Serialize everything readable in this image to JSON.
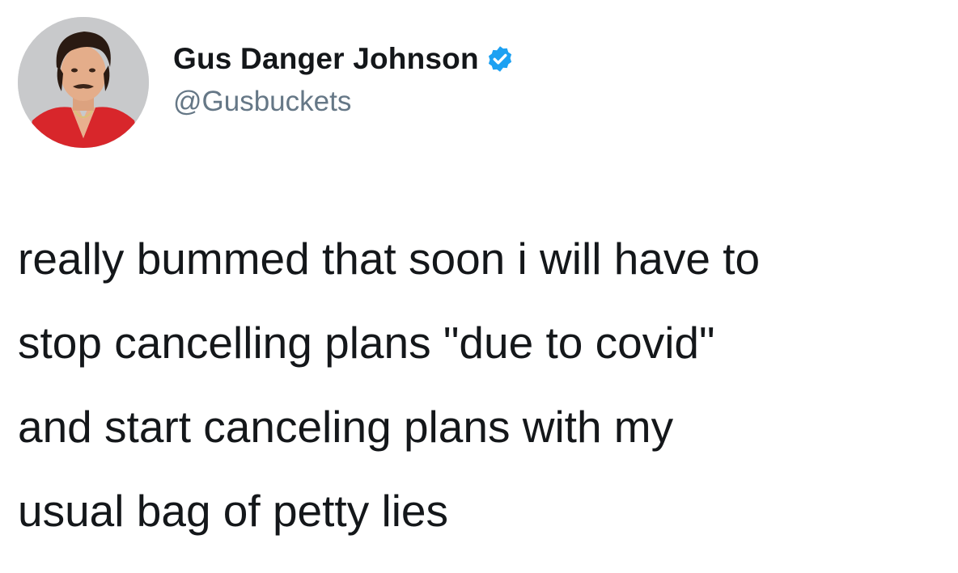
{
  "author": {
    "display_name": "Gus Danger Johnson",
    "handle": "@Gusbuckets",
    "verified": true,
    "avatar_icon": "profile-photo-avatar",
    "verified_icon": "verified-badge-icon"
  },
  "tweet": {
    "lines": [
      "really bummed that soon i will have to",
      "stop cancelling plans \"due to covid\"",
      "and start canceling plans with my",
      "usual bag of petty lies"
    ]
  },
  "colors": {
    "background": "#ffffff",
    "text": "#14171a",
    "secondary_text": "#657786",
    "verified_blue": "#1da1f2"
  }
}
